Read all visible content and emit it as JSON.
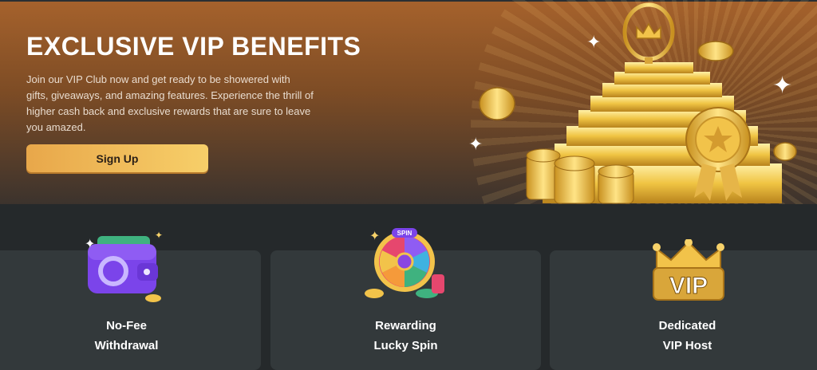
{
  "hero": {
    "title": "EXCLUSIVE VIP BENEFITS",
    "description": "Join our VIP Club now and get ready to be showered with gifts, giveaways, and amazing features. Experience the thrill of higher cash back and exclusive rewards that are sure to leave you amazed.",
    "signup_label": "Sign Up"
  },
  "benefits": [
    {
      "line1": "No-Fee",
      "line2": "Withdrawal",
      "icon": "wallet-icon"
    },
    {
      "line1": "Rewarding",
      "line2": "Lucky Spin",
      "icon": "spin-wheel-icon",
      "badge": "SPIN"
    },
    {
      "line1": "Dedicated",
      "line2": "VIP Host",
      "icon": "vip-crown-icon",
      "badge": "VIP"
    }
  ],
  "colors": {
    "hero_top": "#a6622c",
    "page_bg": "#25292b",
    "card_bg": "#33393b",
    "button_start": "#e8a74a",
    "button_end": "#f7cf69",
    "gold": "#f2c34a"
  }
}
